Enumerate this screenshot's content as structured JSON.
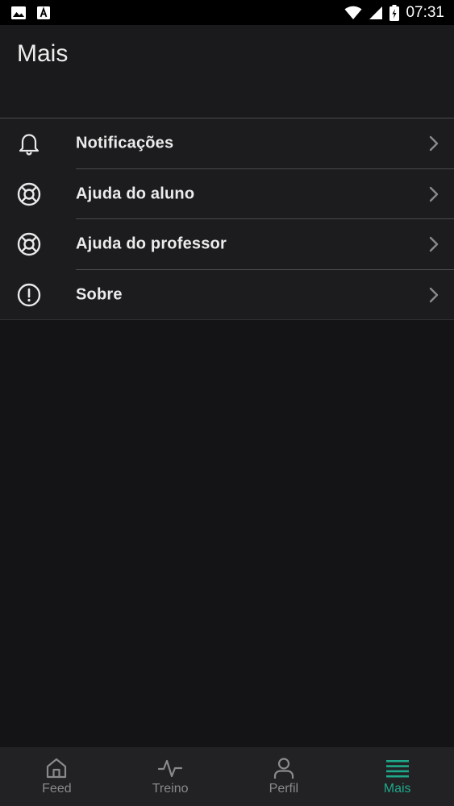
{
  "status_bar": {
    "time": "07:31",
    "left_icons": [
      "image-icon",
      "font-icon"
    ],
    "right_icons": [
      "wifi-icon",
      "signal-icon",
      "battery-charging-icon"
    ]
  },
  "header": {
    "title": "Mais"
  },
  "menu": {
    "items": [
      {
        "label": "Notificações",
        "icon": "bell-icon"
      },
      {
        "label": "Ajuda do aluno",
        "icon": "lifebuoy-icon"
      },
      {
        "label": "Ajuda do professor",
        "icon": "lifebuoy-icon"
      },
      {
        "label": "Sobre",
        "icon": "info-circle-icon"
      }
    ]
  },
  "bottom_nav": {
    "items": [
      {
        "label": "Feed",
        "icon": "home-icon",
        "active": false
      },
      {
        "label": "Treino",
        "icon": "activity-icon",
        "active": false
      },
      {
        "label": "Perfil",
        "icon": "user-icon",
        "active": false
      },
      {
        "label": "Mais",
        "icon": "menu-lines-icon",
        "active": true
      }
    ]
  },
  "colors": {
    "background": "#141315",
    "header": "#1a191b",
    "list": "#1c1b1e",
    "divider": "#4a494c",
    "nav_background": "#222124",
    "nav_inactive": "#8a898c",
    "accent": "#1fa98a"
  }
}
